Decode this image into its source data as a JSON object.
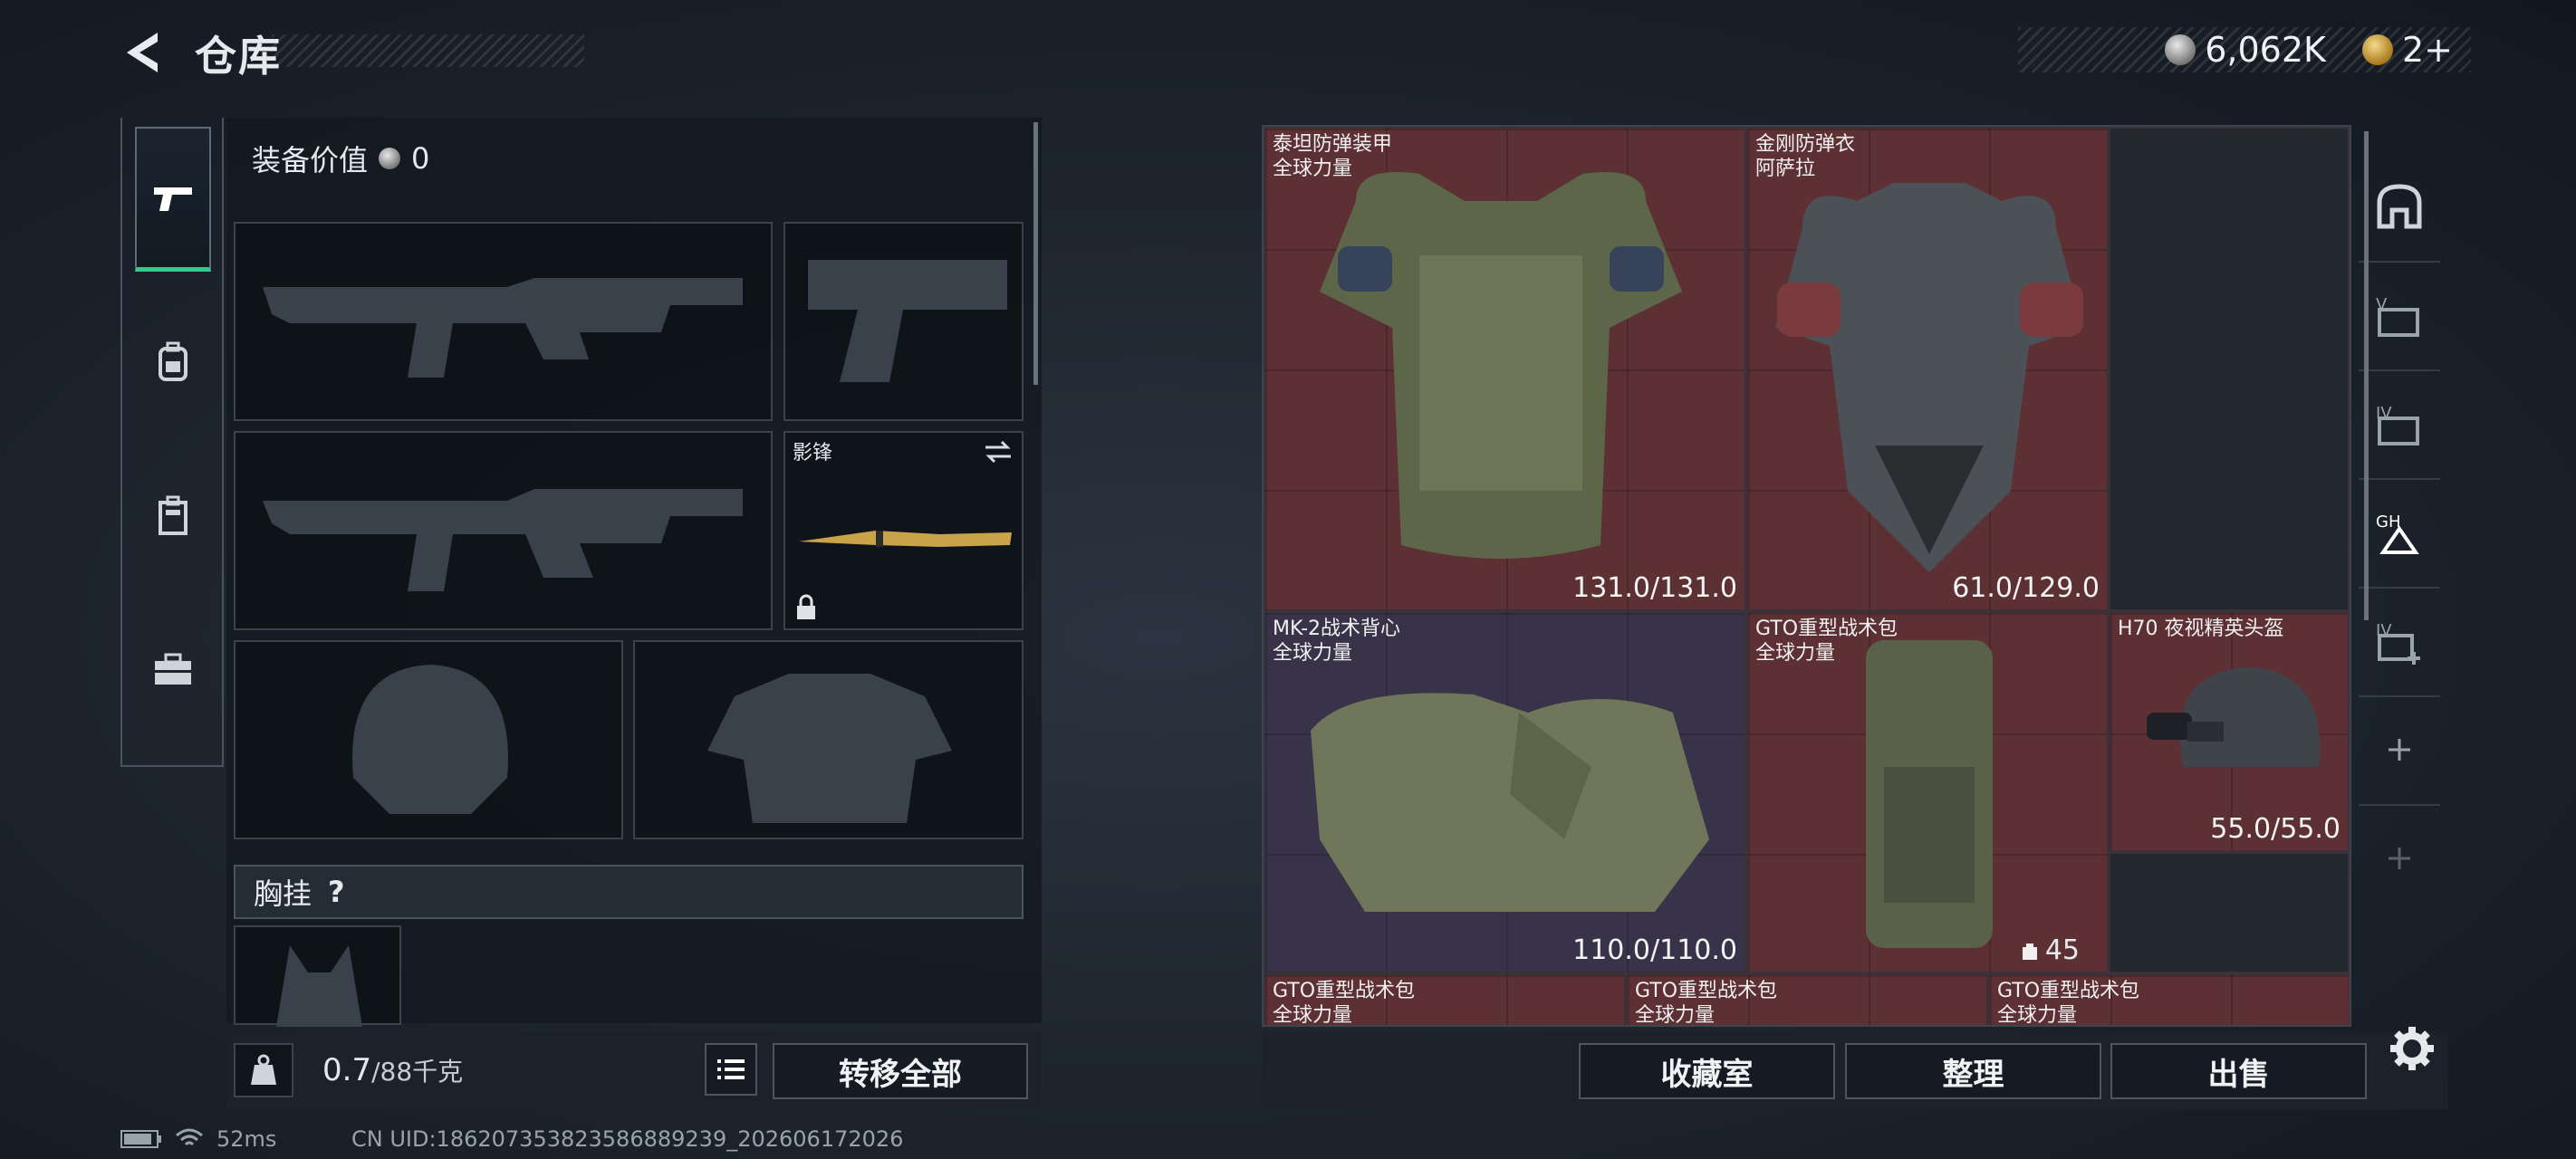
{
  "header": {
    "title": "仓库",
    "silver_amount": "6,062K",
    "gold_amount": "2+"
  },
  "left": {
    "equip_value_label": "装备价值",
    "equip_value": "0",
    "melee_name": "影锋",
    "chest_label": "胸挂",
    "chest_help": "?",
    "weight_value": "0.7",
    "weight_max": "/88千克",
    "transfer_all": "转移全部",
    "rail_tabs": [
      "weapons",
      "backpack",
      "container",
      "toolbox"
    ]
  },
  "grid": {
    "items": [
      {
        "name": "泰坦防弹装甲",
        "sub": "全球力量",
        "durability": "131.0/131.0",
        "color": "red"
      },
      {
        "name": "金刚防弹衣",
        "sub": "阿萨拉",
        "durability": "61.0/129.0",
        "color": "red"
      },
      {
        "name": "MK-2战术背心",
        "sub": "全球力量",
        "durability": "110.0/110.0",
        "color": "purple"
      },
      {
        "name": "GTO重型战术包",
        "sub": "全球力量",
        "count": "45",
        "color": "red"
      },
      {
        "name": "H70 夜视精英头盔",
        "sub": "",
        "durability": "55.0/55.0",
        "color": "red"
      },
      {
        "name": "GTO重型战术包",
        "sub": "全球力量",
        "color": "red"
      },
      {
        "name": "GTO重型战术包",
        "sub": "全球力量",
        "color": "red"
      },
      {
        "name": "GTO重型战术包",
        "sub": "全球力量",
        "color": "red"
      }
    ]
  },
  "bottom_buttons": {
    "collection": "收藏室",
    "organize": "整理",
    "sell": "出售"
  },
  "right_rail": [
    "home-icon",
    "V-icon",
    "IV-icon",
    "GH-icon",
    "IV-plus-icon",
    "plus",
    "plus"
  ],
  "status": {
    "ping": "52ms",
    "uid": "CN UID:186207353823586889239_202606172026"
  },
  "colors": {
    "accent_green": "#36c98e",
    "item_red": "#5d3034",
    "item_purple": "#39334a"
  }
}
